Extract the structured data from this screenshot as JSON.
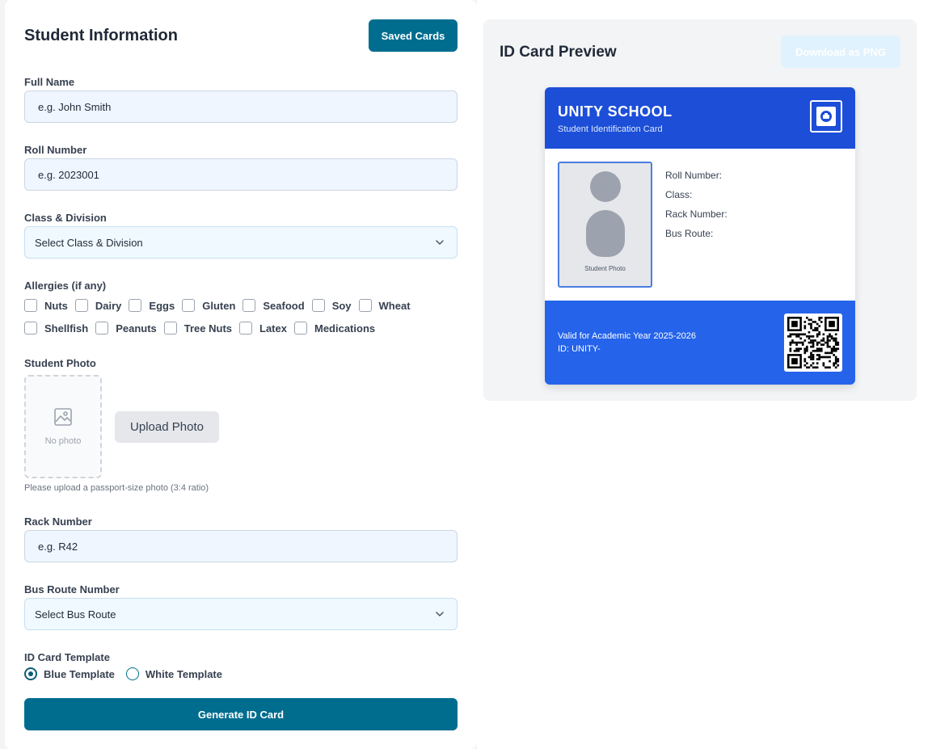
{
  "form": {
    "title": "Student Information",
    "saved_cards_label": "Saved Cards",
    "full_name": {
      "label": "Full Name",
      "placeholder": "e.g. John Smith"
    },
    "roll_number": {
      "label": "Roll Number",
      "placeholder": "e.g. 2023001"
    },
    "class_division": {
      "label": "Class & Division",
      "value": "Select Class & Division"
    },
    "allergies": {
      "label": "Allergies (if any)",
      "row1": [
        "Nuts",
        "Dairy",
        "Eggs",
        "Gluten",
        "Seafood",
        "Soy",
        "Wheat"
      ],
      "row2": [
        "Shellfish",
        "Peanuts",
        "Tree Nuts",
        "Latex",
        "Medications"
      ]
    },
    "photo": {
      "label": "Student Photo",
      "placeholder_text": "No photo",
      "upload_label": "Upload Photo",
      "hint": "Please upload a passport-size photo (3:4 ratio)"
    },
    "rack_number": {
      "label": "Rack Number",
      "placeholder": "e.g. R42"
    },
    "bus_route": {
      "label": "Bus Route Number",
      "value": "Select Bus Route"
    },
    "template": {
      "label": "ID Card Template",
      "options": [
        {
          "label": "Blue Template",
          "selected": true
        },
        {
          "label": "White Template",
          "selected": false
        }
      ]
    },
    "generate_label": "Generate ID Card"
  },
  "preview": {
    "title": "ID Card Preview",
    "download_label": "Download as PNG",
    "card": {
      "school_name": "UNITY SCHOOL",
      "subtitle": "Student Identification Card",
      "photo_caption": "Student Photo",
      "fields": [
        "Roll Number:",
        "Class:",
        "Rack Number:",
        "Bus Route:"
      ],
      "validity": "Valid for Academic Year 2025-2026",
      "id_text": "ID: UNITY-",
      "colors": {
        "header": "#1d4ed8",
        "footer": "#2563eb"
      }
    }
  },
  "icons": [
    "chevron-down-icon",
    "image-placeholder-icon",
    "school-logo-icon",
    "qr-code"
  ]
}
